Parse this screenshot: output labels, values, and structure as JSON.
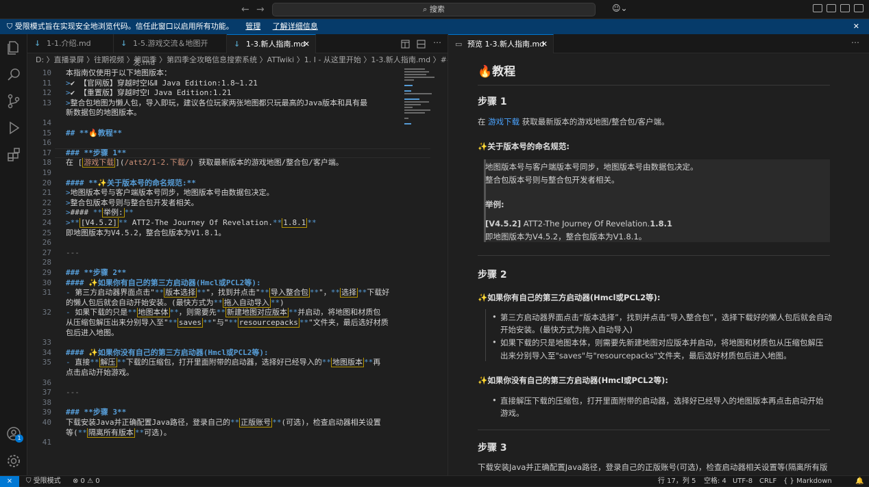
{
  "titlebar": {
    "search": "搜索",
    "back": "←",
    "forward": "→"
  },
  "banner": {
    "text": "受限模式旨在实现安全地浏览代码。信任此窗口以启用所有功能。",
    "manage": "管理",
    "learn": "了解详细信息",
    "close": "✕"
  },
  "tabs": [
    {
      "label": "1-1.介绍.md"
    },
    {
      "label": "1-5.游戏交流＆地图开发.md"
    },
    {
      "label": "1-3.新人指南.md",
      "close": "✕"
    }
  ],
  "preview_tab": {
    "label": "预览 1-3.新人指南.md",
    "close": "✕"
  },
  "breadcrumb": "D: 〉直播录屏 〉往期视频 〉第四季 〉第四季全攻略信息搜索系统 〉ATTwiki 〉1. Ⅰ - 从这里开始 〉1-3.新人指南.md 〉##",
  "code": [
    {
      "n": "10",
      "t": "本指南仅使用于以下地图版本："
    },
    {
      "n": "11",
      "t": ">✔ 【官网版】穿越时空Ⅰ&Ⅱ Java Edition:1.8~1.21"
    },
    {
      "n": "12",
      "t": ">✔ 【重置版】穿越时空Ⅰ Java Edition:1.21"
    },
    {
      "n": "13",
      "t": ">整合包地图为懒人包，导入即玩，建议各位玩家两张地图都只玩最高的Java版本和具有最"
    },
    {
      "n": "",
      "t": "新数据包的地图版本。"
    },
    {
      "n": "14",
      "t": ""
    },
    {
      "n": "15",
      "t": "## **🔥教程**"
    },
    {
      "n": "16",
      "t": ""
    },
    {
      "n": "17",
      "t": "### **步骤 1**"
    },
    {
      "n": "18",
      "t": "在 [游戏下载](/att2/1-2.下载/) 获取最新版本的游戏地图/整合包/客户端。"
    },
    {
      "n": "19",
      "t": ""
    },
    {
      "n": "20",
      "t": "#### **✨关于版本号的命名规范:**"
    },
    {
      "n": "21",
      "t": ">地图版本号与客户端版本号同步，地图版本号由数据包决定。"
    },
    {
      "n": "22",
      "t": ">整合包版本号则与整合包开发者相关。"
    },
    {
      "n": "23",
      "t": ">#### **举例:**"
    },
    {
      "n": "24",
      "t": ">**[V4.5.2]** ATT2-The Journey Of Revelation.**1.8.1**"
    },
    {
      "n": "25",
      "t": "即地图版本为V4.5.2，整合包版本为V1.8.1。"
    },
    {
      "n": "26",
      "t": ""
    },
    {
      "n": "27",
      "t": "---"
    },
    {
      "n": "28",
      "t": ""
    },
    {
      "n": "29",
      "t": "### **步骤 2**"
    },
    {
      "n": "30",
      "t": "#### ✨如果你有自己的第三方启动器(Hmcl或PCL2等):"
    },
    {
      "n": "31",
      "t": "- 第三方启动器界面点击\"**版本选择**\"，找到并点击\"**导入整合包**\"，**选择**下载好"
    },
    {
      "n": "",
      "t": "的懒人包后就会自动开始安装。(最快方式为**拖入自动导入**)"
    },
    {
      "n": "32",
      "t": "- 如果下载的只是**地图本体**，则需要先**新建地图对应版本**并启动，将地图和材质包"
    },
    {
      "n": "",
      "t": "从压缩包解压出来分别导入至\"**saves**\"与\"**resourcepacks**\"文件夹，最后选好材质"
    },
    {
      "n": "",
      "t": "包后进入地图。"
    },
    {
      "n": "33",
      "t": ""
    },
    {
      "n": "34",
      "t": "#### ✨如果你没有自己的第三方启动器(Hmcl或PCL2等):"
    },
    {
      "n": "35",
      "t": "- 直接**解压**下载的压缩包，打开里面附带的启动器，选择好已经导入的**地图版本**再"
    },
    {
      "n": "",
      "t": "点击启动开始游戏。"
    },
    {
      "n": "36",
      "t": ""
    },
    {
      "n": "37",
      "t": "---"
    },
    {
      "n": "38",
      "t": ""
    },
    {
      "n": "39",
      "t": "### **步骤 3**"
    },
    {
      "n": "40",
      "t": "下载安装Java并正确配置Java路径，登录自己的**正版账号**(可选)，检查启动器相关设置"
    },
    {
      "n": "",
      "t": "等(**隔离所有版本**可选)。"
    },
    {
      "n": "41",
      "t": ""
    }
  ],
  "preview": {
    "h1": "🔥教程",
    "step1": "步骤 1",
    "p1_pre": "在 ",
    "p1_link": "游戏下载",
    "p1_post": " 获取最新版本的游戏地图/整合包/客户端。",
    "naming_title": "✨关于版本号的命名规范:",
    "q1": "地图版本号与客户端版本号同步，地图版本号由数据包决定。",
    "q2": "整合包版本号则与整合包开发者相关。",
    "example": "举例:",
    "q3_b1": "[V4.5.2]",
    "q3_mid": " ATT2-The Journey Of Revelation.",
    "q3_b2": "1.8.1",
    "q4": "即地图版本为V4.5.2，整合包版本为V1.8.1。",
    "step2": "步骤 2",
    "has_launcher": "✨如果你有自己的第三方启动器(Hmcl或PCL2等):",
    "li1a": "第三方启动器界面点击“版本选择”，找到并点击“导入整合包”，选择下载好的懒人包后就会自动",
    "li1b": "开始安装。(最快方式为拖入自动导入)",
    "li2a": "如果下载的只是地图本体，则需要先新建地图对应版本并启动，将地图和材质包从压缩包解压",
    "li2b": "出来分别导入至\"saves\"与\"resourcepacks\"文件夹，最后选好材质包后进入地图。",
    "no_launcher": "✨如果你没有自己的第三方启动器(Hmcl或PCL2等):",
    "li3a": "直接解压下载的压缩包，打开里面附带的启动器，选择好已经导入的地图版本再点击启动开始",
    "li3b": "游戏。",
    "step3": "步骤 3",
    "p3": "下载安装Java并正确配置Java路径，登录自己的正版账号(可选)，检查启动器相关设置等(隔离所有版"
  },
  "status": {
    "restricted": "受限模式",
    "problems": "⊗ 0 ⚠ 0",
    "position": "行 17，列 5",
    "spaces": "空格: 4",
    "encoding": "UTF-8",
    "eol": "CRLF",
    "language": "{ } Markdown",
    "badge": "1"
  }
}
